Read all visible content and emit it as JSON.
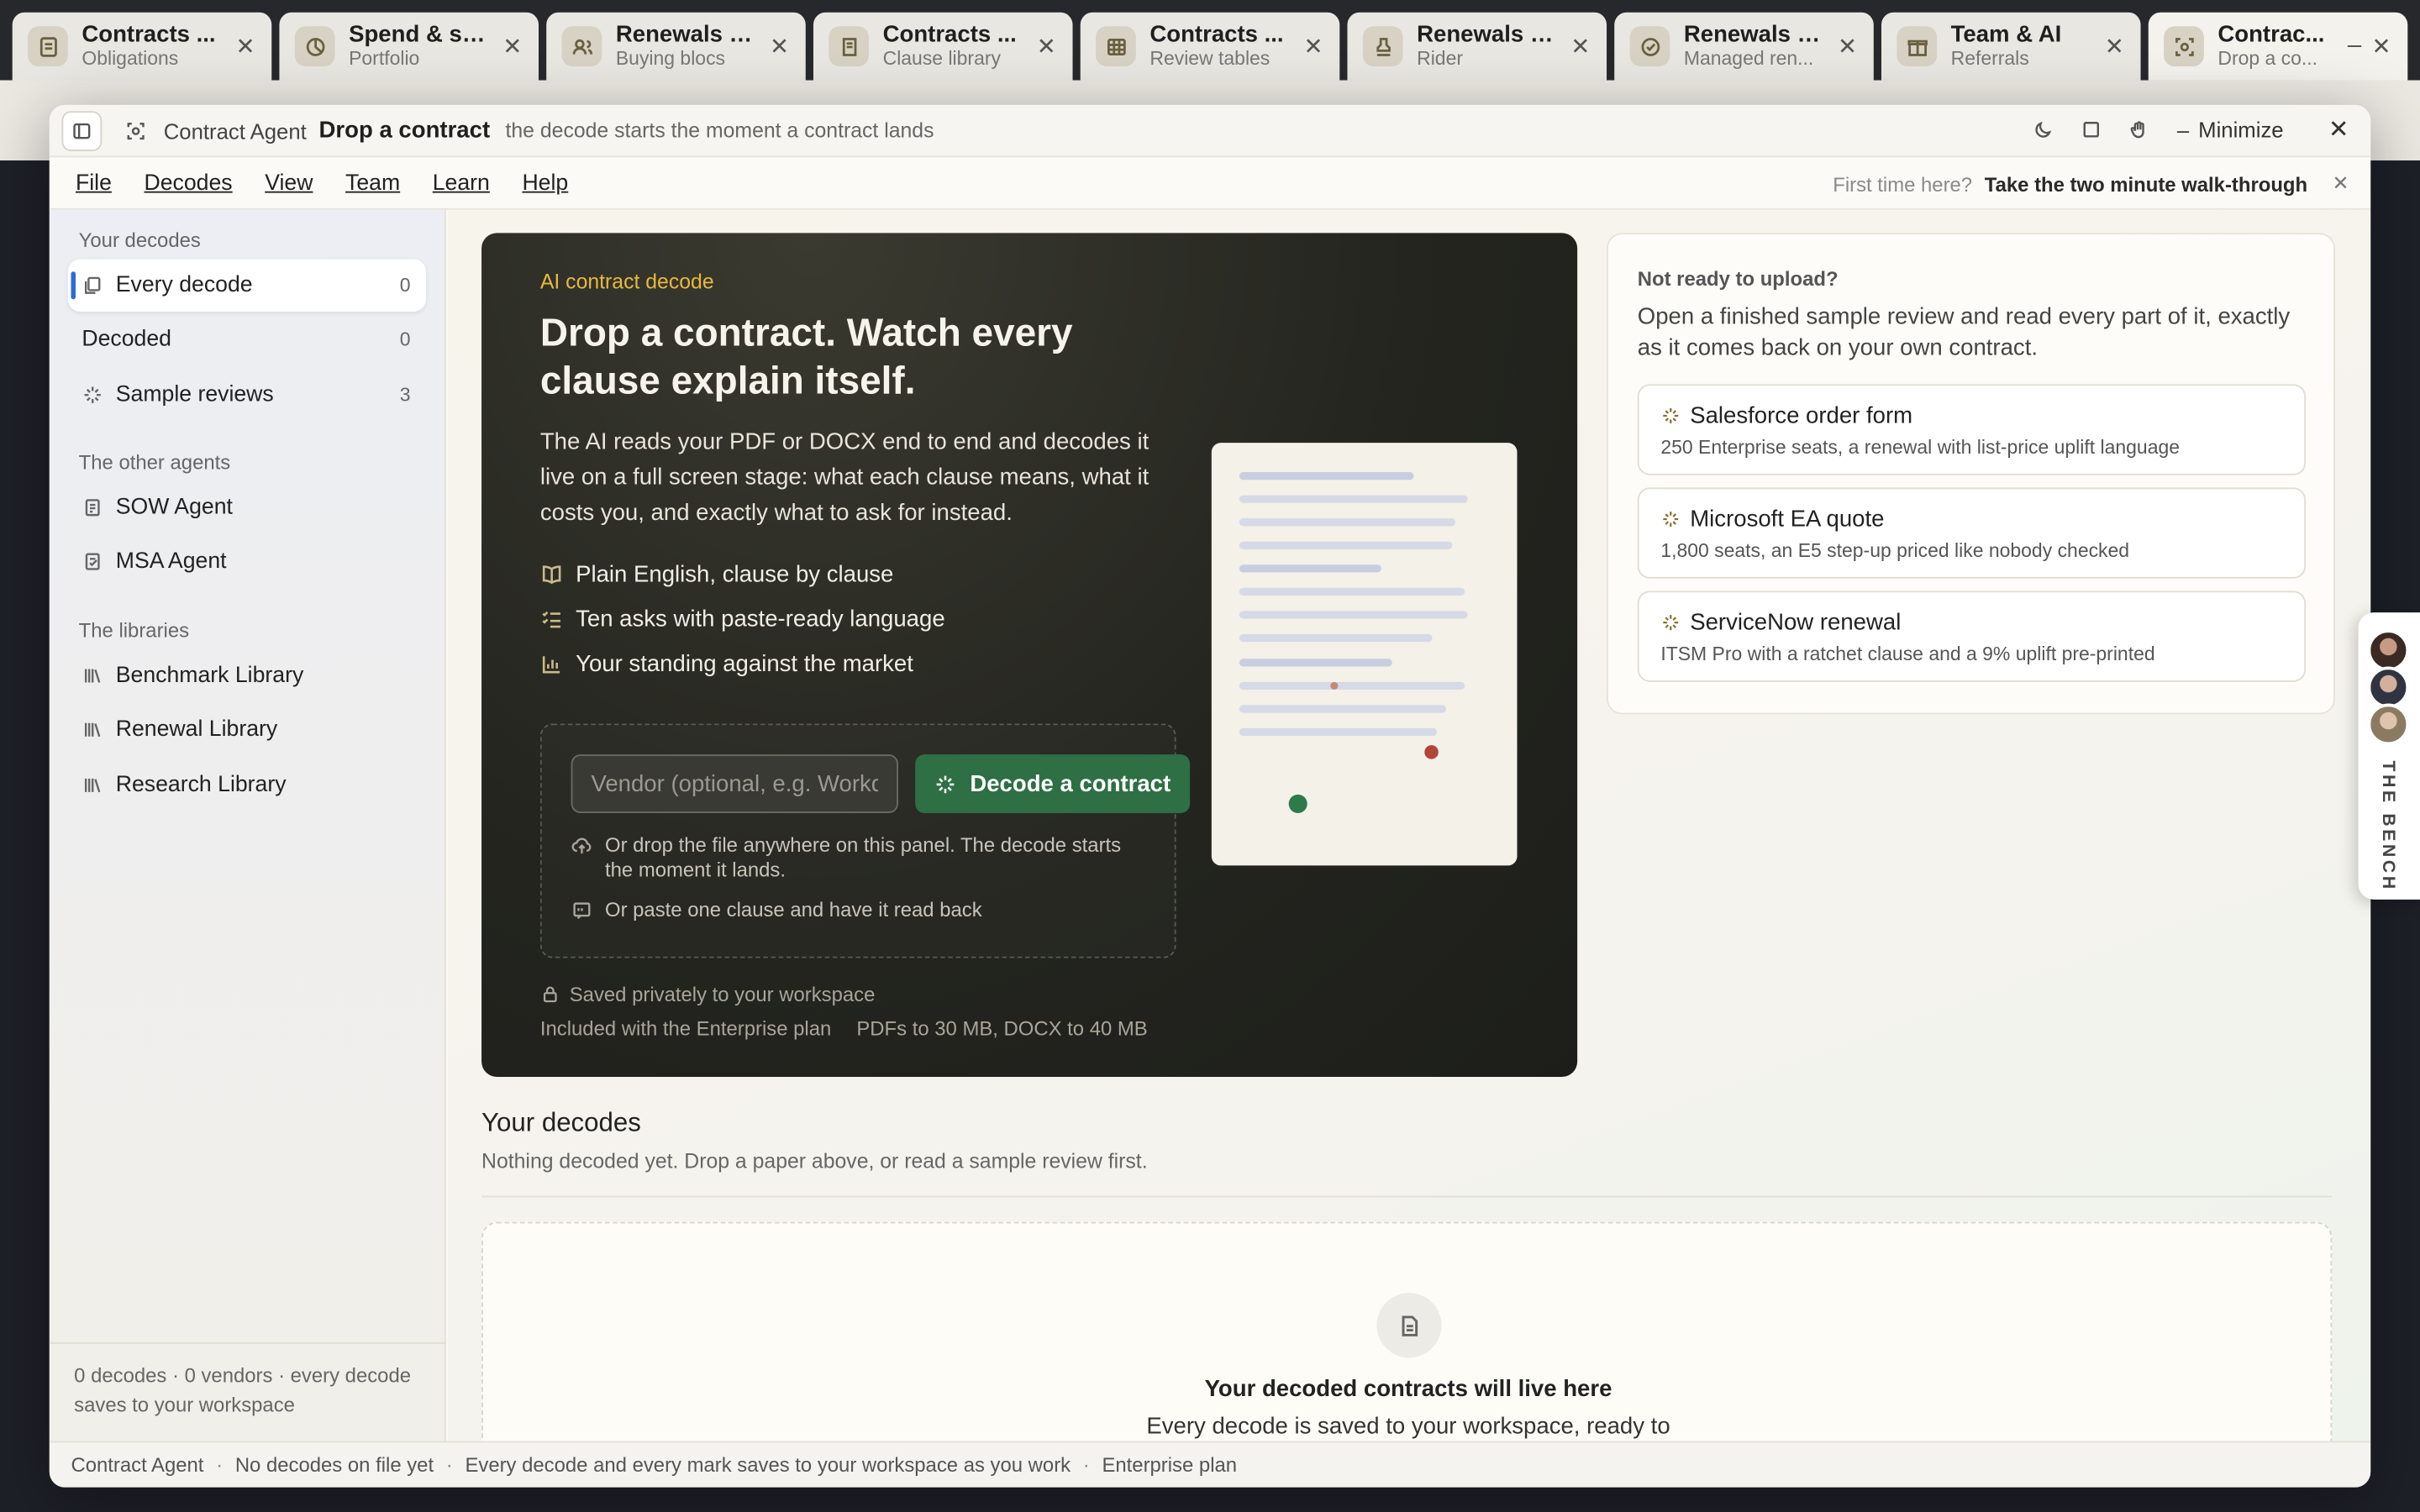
{
  "tabs": [
    {
      "title": "Contracts ...",
      "sub": "Obligations",
      "icon": "scroll-icon"
    },
    {
      "title": "Spend & sa...",
      "sub": "Portfolio",
      "icon": "pie-icon"
    },
    {
      "title": "Renewals &...",
      "sub": "Buying blocs",
      "icon": "people-icon"
    },
    {
      "title": "Contracts ...",
      "sub": "Clause library",
      "icon": "book-icon"
    },
    {
      "title": "Contracts ...",
      "sub": "Review tables",
      "icon": "table-icon"
    },
    {
      "title": "Renewals &...",
      "sub": "Rider",
      "icon": "stamp-icon"
    },
    {
      "title": "Renewals &...",
      "sub": "Managed ren...",
      "icon": "check-badge-icon"
    },
    {
      "title": "Team & AI",
      "sub": "Referrals",
      "icon": "gift-icon"
    },
    {
      "title": "Contrac...",
      "sub": "Drop a co...",
      "icon": "scan-icon"
    }
  ],
  "window": {
    "app_name": "Contract Agent",
    "title": "Drop a contract",
    "subtitle": "the decode starts the moment a contract lands",
    "minimize_label": "Minimize"
  },
  "menu": {
    "items": [
      "File",
      "Decodes",
      "View",
      "Team",
      "Learn",
      "Help"
    ],
    "walk_q": "First time here?",
    "walk_link": "Take the two minute walk-through"
  },
  "sidebar": {
    "your_decodes_head": "Your decodes",
    "items": [
      {
        "label": "Every decode",
        "count": "0"
      },
      {
        "label": "Decoded",
        "count": "0"
      },
      {
        "label": "Sample reviews",
        "count": "3"
      }
    ],
    "agents_head": "The other agents",
    "agents": [
      "SOW Agent",
      "MSA Agent"
    ],
    "libraries_head": "The libraries",
    "libraries": [
      "Benchmark Library",
      "Renewal Library",
      "Research Library"
    ],
    "footer": "0 decodes · 0 vendors · every decode saves to your workspace"
  },
  "hero": {
    "eyebrow": "AI contract decode",
    "headline": "Drop a contract. Watch every clause explain itself.",
    "body": "The AI reads your PDF or DOCX end to end and decodes it live on a full screen stage: what each clause means, what it costs you, and exactly what to ask for instead.",
    "features": [
      "Plain English, clause by clause",
      "Ten asks with paste-ready language",
      "Your standing against the market"
    ],
    "vendor_placeholder": "Vendor (optional, e.g. Workday)",
    "decode_button": "Decode a contract",
    "drop_hint": "Or drop the file anywhere on this panel. The decode starts the moment it lands.",
    "paste_hint": "Or paste one clause and have it read back",
    "privacy": "Saved privately to your workspace",
    "plan": "Included with the Enterprise plan",
    "limits": "PDFs to 30 MB, DOCX to 40 MB"
  },
  "samples": {
    "head": "Not ready to upload?",
    "body": "Open a finished sample review and read every part of it, exactly as it comes back on your own contract.",
    "items": [
      {
        "title": "Salesforce order form",
        "sub": "250 Enterprise seats, a renewal with list-price uplift language"
      },
      {
        "title": "Microsoft EA quote",
        "sub": "1,800 seats, an E5 step-up priced like nobody checked"
      },
      {
        "title": "ServiceNow renewal",
        "sub": "ITSM Pro with a ratchet clause and a 9% uplift pre-printed"
      }
    ]
  },
  "decodes": {
    "title": "Your decodes",
    "subtitle": "Nothing decoded yet. Drop a paper above, or read a sample review first.",
    "empty_title": "Your decoded contracts will live here",
    "empty_sub": "Every decode is saved to your workspace, ready to"
  },
  "status": {
    "items": [
      "Contract Agent",
      "No decodes on file yet",
      "Every decode and every mark saves to your workspace as you work",
      "Enterprise plan"
    ]
  },
  "bench": {
    "label": "THE BENCH"
  },
  "colors": {
    "accent_green": "#2e6f43",
    "eyebrow_gold": "#e7b93f",
    "selected_bar": "#2f6bd8"
  }
}
